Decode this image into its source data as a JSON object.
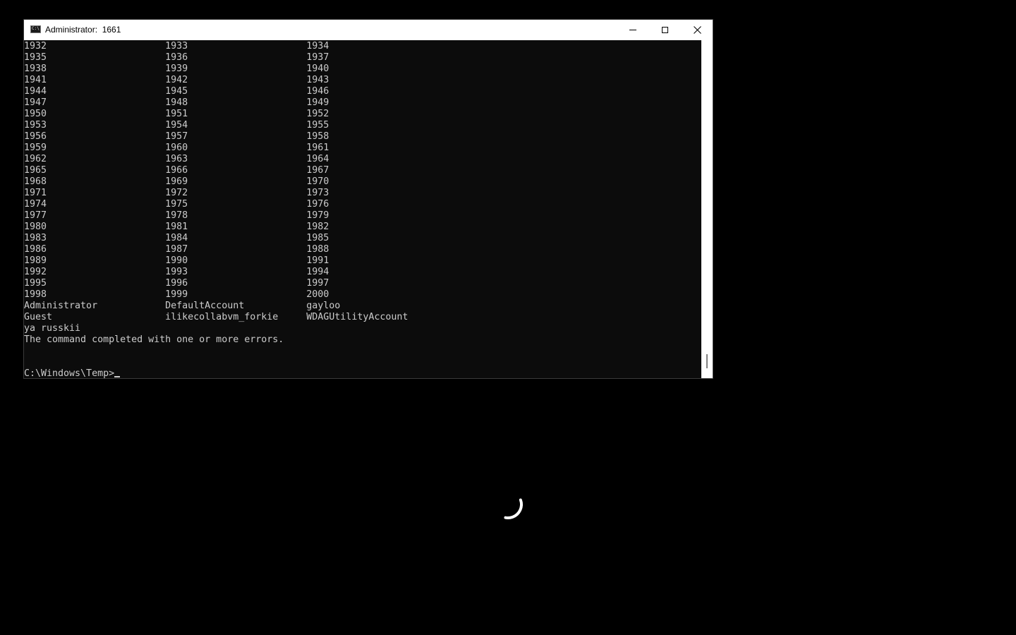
{
  "window": {
    "title": "Administrator:  1661",
    "icon": "console-icon",
    "icon_text": "C:\\",
    "controls": {
      "minimize": "minimize-icon",
      "maximize": "maximize-icon",
      "close": "close-icon"
    }
  },
  "console": {
    "lines": [
      "1932                     1933                     1934",
      "1935                     1936                     1937",
      "1938                     1939                     1940",
      "1941                     1942                     1943",
      "1944                     1945                     1946",
      "1947                     1948                     1949",
      "1950                     1951                     1952",
      "1953                     1954                     1955",
      "1956                     1957                     1958",
      "1959                     1960                     1961",
      "1962                     1963                     1964",
      "1965                     1966                     1967",
      "1968                     1969                     1970",
      "1971                     1972                     1973",
      "1974                     1975                     1976",
      "1977                     1978                     1979",
      "1980                     1981                     1982",
      "1983                     1984                     1985",
      "1986                     1987                     1988",
      "1989                     1990                     1991",
      "1992                     1993                     1994",
      "1995                     1996                     1997",
      "1998                     1999                     2000",
      "Administrator            DefaultAccount           gayloo",
      "Guest                    ilikecollabvm_forkie     WDAGUtilityAccount",
      "ya russkii",
      "The command completed with one or more errors.",
      "",
      ""
    ],
    "prompt": "C:\\Windows\\Temp>"
  },
  "colors": {
    "desktop_background": "#000000",
    "console_background": "#0c0c0c",
    "console_foreground": "#cccccc",
    "titlebar_background": "#ffffff",
    "spinner": "#ffffff"
  },
  "spinner": {
    "icon": "loading-spinner-icon"
  }
}
